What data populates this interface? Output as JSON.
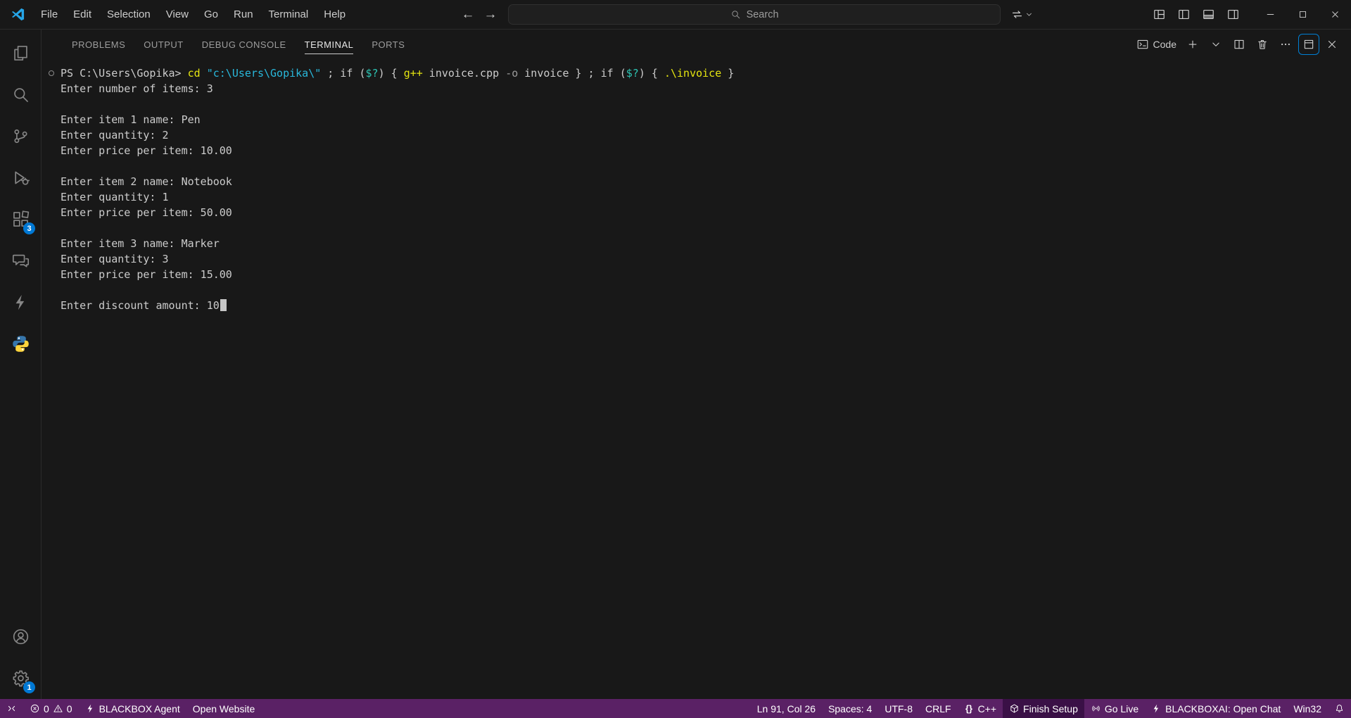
{
  "colors": {
    "accent": "#0078d4",
    "statusbar_bg": "#5a2165",
    "statusbar_emphasis_bg": "#3a1046",
    "terminal_default": "#cccccc",
    "terminal_command": "#e5e510",
    "terminal_string": "#29b8db",
    "terminal_variable": "#2dc5b4",
    "terminal_parameter": "#9b9b9b"
  },
  "title_bar": {
    "menus": [
      "File",
      "Edit",
      "Selection",
      "View",
      "Go",
      "Run",
      "Terminal",
      "Help"
    ],
    "nav_buttons": [
      {
        "name": "go-back",
        "icon": "arrow-left"
      },
      {
        "name": "go-forward",
        "icon": "arrow-right"
      }
    ],
    "search": {
      "placeholder": "Search"
    },
    "right_of_search": [
      {
        "name": "switch-window",
        "icon": "sync",
        "chevron": true
      }
    ],
    "layout_buttons": [
      {
        "name": "customize-layout",
        "icon": "layout"
      },
      {
        "name": "toggle-primary-sidebar",
        "icon": "layout-sidebar-left"
      },
      {
        "name": "toggle-panel",
        "icon": "layout-panel"
      },
      {
        "name": "toggle-secondary-sidebar",
        "icon": "layout-sidebar-right"
      }
    ],
    "window_controls": [
      {
        "name": "minimize",
        "icon": "chrome-minimize"
      },
      {
        "name": "maximize",
        "icon": "chrome-maximize"
      },
      {
        "name": "close",
        "icon": "chrome-close"
      }
    ]
  },
  "activity_bar": {
    "top_items": [
      {
        "name": "explorer",
        "icon": "files"
      },
      {
        "name": "search",
        "icon": "search"
      },
      {
        "name": "source-control",
        "icon": "source-control"
      },
      {
        "name": "run-and-debug",
        "icon": "debug"
      },
      {
        "name": "extensions",
        "icon": "extensions",
        "badge": "3"
      },
      {
        "name": "chat",
        "icon": "chat"
      },
      {
        "name": "blackbox",
        "icon": "bolt"
      },
      {
        "name": "python",
        "icon": "python"
      }
    ],
    "bottom_items": [
      {
        "name": "accounts",
        "icon": "account"
      },
      {
        "name": "settings",
        "icon": "gear",
        "badge": "1"
      }
    ]
  },
  "panel": {
    "tabs": [
      {
        "label": "PROBLEMS",
        "active": false
      },
      {
        "label": "OUTPUT",
        "active": false
      },
      {
        "label": "DEBUG CONSOLE",
        "active": false
      },
      {
        "label": "TERMINAL",
        "active": true
      },
      {
        "label": "PORTS",
        "active": false
      }
    ],
    "actions": [
      {
        "name": "launch-profile",
        "icon": "terminal",
        "label": "Code"
      },
      {
        "name": "new-terminal",
        "icon": "plus"
      },
      {
        "name": "launch-profile-dropdown",
        "icon": "chevron-down"
      },
      {
        "name": "split-terminal",
        "icon": "split-horizontal"
      },
      {
        "name": "kill-terminal",
        "icon": "trash"
      },
      {
        "name": "more-actions",
        "icon": "ellipsis"
      },
      {
        "name": "maximize-panel",
        "icon": "panel-maximize",
        "focused": true
      },
      {
        "name": "close-panel",
        "icon": "close"
      }
    ]
  },
  "terminal": {
    "lines": [
      {
        "decoration": true,
        "segments": [
          {
            "text": "PS C:\\Users\\Gopika> ",
            "color": "default"
          },
          {
            "text": "cd",
            "color": "command"
          },
          {
            "text": " ",
            "color": "default"
          },
          {
            "text": "\"c:\\Users\\Gopika\\\"",
            "color": "string"
          },
          {
            "text": " ; if (",
            "color": "default"
          },
          {
            "text": "$?",
            "color": "variable"
          },
          {
            "text": ") { ",
            "color": "default"
          },
          {
            "text": "g++",
            "color": "command"
          },
          {
            "text": " invoice.cpp ",
            "color": "default"
          },
          {
            "text": "-o",
            "color": "parameter"
          },
          {
            "text": " invoice } ; if (",
            "color": "default"
          },
          {
            "text": "$?",
            "color": "variable"
          },
          {
            "text": ") { ",
            "color": "default"
          },
          {
            "text": ".\\invoice",
            "color": "command"
          },
          {
            "text": " }",
            "color": "default"
          }
        ]
      },
      {
        "segments": [
          {
            "text": "Enter number of items: 3"
          }
        ]
      },
      {
        "segments": []
      },
      {
        "segments": [
          {
            "text": "Enter item 1 name: Pen"
          }
        ]
      },
      {
        "segments": [
          {
            "text": "Enter quantity: 2"
          }
        ]
      },
      {
        "segments": [
          {
            "text": "Enter price per item: 10.00"
          }
        ]
      },
      {
        "segments": []
      },
      {
        "segments": [
          {
            "text": "Enter item 2 name: Notebook"
          }
        ]
      },
      {
        "segments": [
          {
            "text": "Enter quantity: 1"
          }
        ]
      },
      {
        "segments": [
          {
            "text": "Enter price per item: 50.00"
          }
        ]
      },
      {
        "segments": []
      },
      {
        "segments": [
          {
            "text": "Enter item 3 name: Marker"
          }
        ]
      },
      {
        "segments": [
          {
            "text": "Enter quantity: 3"
          }
        ]
      },
      {
        "segments": [
          {
            "text": "Enter price per item: 15.00"
          }
        ]
      },
      {
        "segments": []
      },
      {
        "segments": [
          {
            "text": "Enter discount amount: 10"
          },
          {
            "cursor": true
          }
        ]
      }
    ]
  },
  "status_bar": {
    "left": [
      {
        "name": "remote",
        "parts": [
          {
            "icon": "remote"
          }
        ]
      },
      {
        "name": "problems",
        "parts": [
          {
            "icon": "error"
          },
          {
            "text": "0"
          },
          {
            "icon": "warning"
          },
          {
            "text": "0"
          }
        ]
      },
      {
        "name": "blackbox-agent",
        "parts": [
          {
            "icon": "bolt"
          },
          {
            "text": "BLACKBOX Agent"
          }
        ]
      },
      {
        "name": "open-website",
        "parts": [
          {
            "text": "Open Website"
          }
        ]
      }
    ],
    "right": [
      {
        "name": "cursor-position",
        "parts": [
          {
            "text": "Ln 91, Col 26"
          }
        ]
      },
      {
        "name": "indentation",
        "parts": [
          {
            "text": "Spaces: 4"
          }
        ]
      },
      {
        "name": "encoding",
        "parts": [
          {
            "text": "UTF-8"
          }
        ]
      },
      {
        "name": "end-of-line",
        "parts": [
          {
            "text": "CRLF"
          }
        ]
      },
      {
        "name": "language-mode",
        "parts": [
          {
            "icon": "braces"
          },
          {
            "text": "C++"
          }
        ]
      },
      {
        "name": "finish-setup",
        "parts": [
          {
            "icon": "package"
          },
          {
            "text": "Finish Setup"
          }
        ],
        "emphasized": true
      },
      {
        "name": "go-live",
        "parts": [
          {
            "icon": "broadcast"
          },
          {
            "text": "Go Live"
          }
        ]
      },
      {
        "name": "blackboxai-open-chat",
        "parts": [
          {
            "icon": "bolt"
          },
          {
            "text": "BLACKBOXAI: Open Chat"
          }
        ]
      },
      {
        "name": "platform",
        "parts": [
          {
            "text": "Win32"
          }
        ]
      },
      {
        "name": "notifications",
        "parts": [
          {
            "icon": "bell"
          }
        ]
      }
    ]
  }
}
